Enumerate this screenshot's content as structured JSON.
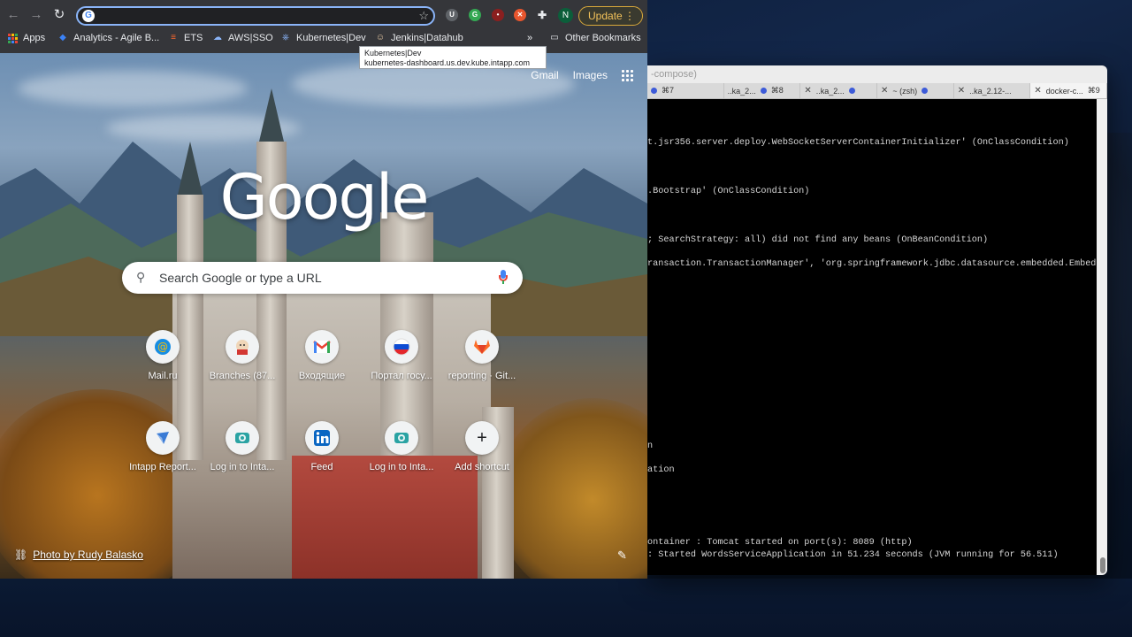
{
  "browser": {
    "omnibox_value": "",
    "update_label": "Update",
    "profile_initial": "N",
    "overflow_label": "»",
    "bookmarks": [
      {
        "label": "Apps",
        "icon": "apps-grid-icon"
      },
      {
        "label": "Analytics - Agile B...",
        "icon": "analytics-icon"
      },
      {
        "label": "ETS",
        "icon": "ets-icon"
      },
      {
        "label": "AWS|SSO",
        "icon": "aws-icon"
      },
      {
        "label": "Kubernetes|Dev",
        "icon": "kubernetes-icon"
      },
      {
        "label": "Jenkins|Datahub",
        "icon": "jenkins-icon"
      }
    ],
    "other_bookmarks": "Other Bookmarks",
    "tooltip": {
      "title": "Kubernetes|Dev",
      "url": "kubernetes-dashboard.us.dev.kube.intapp.com"
    }
  },
  "ntp": {
    "gmail": "Gmail",
    "images": "Images",
    "logo": "Google",
    "search_placeholder": "Search Google or type a URL",
    "shortcuts": [
      {
        "label": "Mail.ru",
        "icon": "mailru-icon",
        "color": "#168de2"
      },
      {
        "label": "Branches (87...",
        "icon": "jenkins-icon",
        "color": "#d33833"
      },
      {
        "label": "Входящие",
        "icon": "gmail-icon",
        "color": "#ea4335"
      },
      {
        "label": "Портал госу...",
        "icon": "gosuslugi-icon",
        "color": "#0d4cd3"
      },
      {
        "label": "reporting · Git...",
        "icon": "gitlab-icon",
        "color": "#fc6d26"
      },
      {
        "label": "Intapp Report...",
        "icon": "intapp-icon",
        "color": "#3a7bd5"
      },
      {
        "label": "Log in to Inta...",
        "icon": "intapp-login-icon",
        "color": "#2aa3a3"
      },
      {
        "label": "Feed",
        "icon": "linkedin-icon",
        "color": "#0a66c2"
      },
      {
        "label": "Log in to Inta...",
        "icon": "intapp-login-icon",
        "color": "#2aa3a3"
      },
      {
        "label": "Add shortcut",
        "icon": "plus-icon",
        "color": "#202124"
      }
    ],
    "photo_credit": "Photo by Rudy Balasko"
  },
  "terminal": {
    "title": "-compose)",
    "tabs": [
      {
        "label": "⌘7",
        "dot": true,
        "close": false
      },
      {
        "label": "..ka_2...",
        "dot": true,
        "shortcut": "⌘8",
        "close": false
      },
      {
        "label": "..ka_2...",
        "dot": true,
        "close": true
      },
      {
        "label": "~ (zsh)",
        "dot": true,
        "close": true
      },
      {
        "label": "..ka_2.12-...",
        "dot": false,
        "close": true
      },
      {
        "label": "docker-c...",
        "shortcut": "⌘9",
        "dot": false,
        "close": true,
        "active": true
      }
    ],
    "lines": [
      "t.jsr356.server.deploy.WebSocketServerContainerInitializer' (OnClassCondition)",
      ".Bootstrap' (OnClassCondition)",
      "; SearchStrategy: all) did not find any beans (OnBeanCondition)",
      "ransaction.TransactionManager', 'org.springframework.jdbc.datasource.embedded.EmbeddedDat",
      "n",
      "ation",
      "ontainer : Tomcat started on port(s): 8089 (http)",
      "         : Started WordsServiceApplication in 51.234 seconds (JVM running for 56.511)"
    ]
  }
}
